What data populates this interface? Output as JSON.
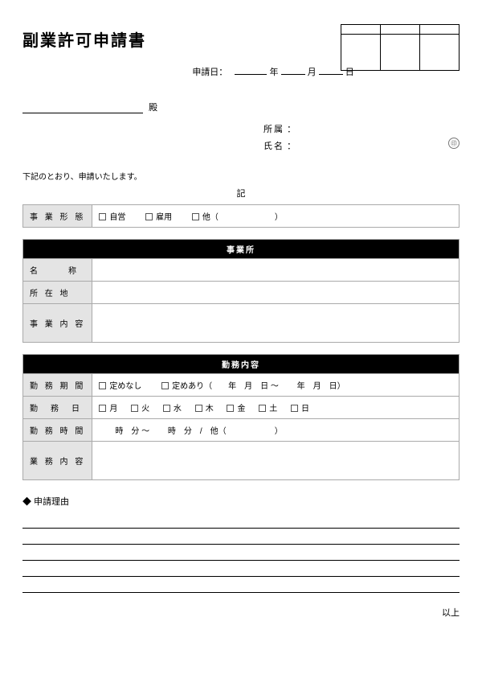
{
  "title": "副業許可申請書",
  "date": {
    "label": "申請日：",
    "year_unit": "年",
    "month_unit": "月",
    "day_unit": "日"
  },
  "addressee_suffix": "殿",
  "from": {
    "dept_label": "所属",
    "colon": "：",
    "name_label": "氏名",
    "seal_char": "㊞"
  },
  "intro": "下記のとおり、申請いたします。",
  "ki": "記",
  "business_type": {
    "label": "事 業 形 態",
    "options": [
      "自営",
      "雇用"
    ],
    "other_label": "他（",
    "other_close": "）"
  },
  "office": {
    "section": "事業所",
    "name_label": "名　　称",
    "addr_label": "所 在 地",
    "content_label": "事 業 内 容"
  },
  "work": {
    "section": "勤務内容",
    "period_label": "勤 務 期 間",
    "period_none": "定めなし",
    "period_fixed_label": "定めあり（",
    "period_fixed_template": "　　年　月　日 ～ 　　年　月　日）",
    "days_label": "勤　務　日",
    "days": [
      "月",
      "火",
      "水",
      "木",
      "金",
      "土",
      "日"
    ],
    "hours_label": "勤 務 時 間",
    "hours_template": "　　時　分 ～ 　　時　分　/　他（",
    "hours_close": "）",
    "content_label": "業 務 内 容"
  },
  "reason_header": "◆ 申請理由",
  "ijou": "以上"
}
